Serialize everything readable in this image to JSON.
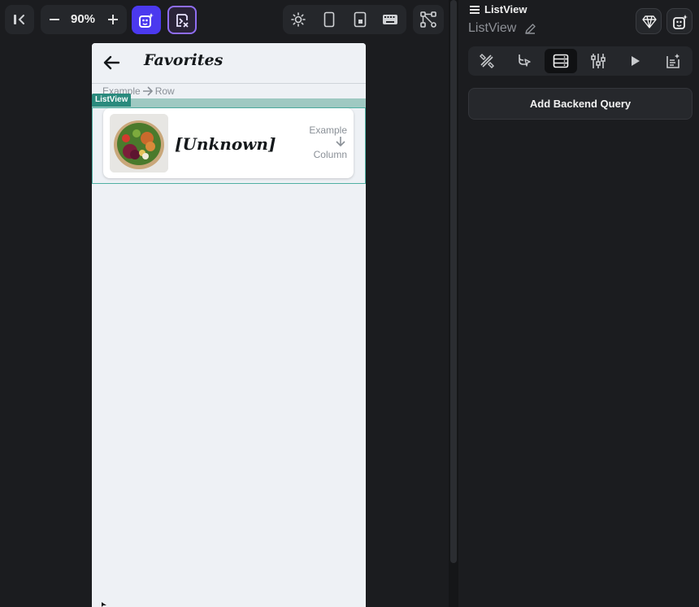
{
  "toolbar": {
    "zoom_value": "90%",
    "icons": [
      "collapse-left-icon",
      "zoom-out-icon",
      "zoom-in-icon",
      "ai-generate-icon",
      "code-check-icon",
      "light-mode-icon",
      "phone-device-icon",
      "tablet-device-icon",
      "keyboard-icon",
      "widget-tree-icon"
    ]
  },
  "phone": {
    "appbar_title": "Favorites",
    "row_hint": {
      "left": "Example",
      "right": "Row"
    },
    "listview_tag": "ListView",
    "card": {
      "title": "[Unknown]",
      "column_hint_top": "Example",
      "column_hint_bottom": "Column"
    }
  },
  "panel": {
    "selected_widget": "ListView",
    "widget_name": "ListView",
    "tabs": [
      {
        "icon": "properties-icon",
        "active": false
      },
      {
        "icon": "actions-icon",
        "active": false
      },
      {
        "icon": "backend-query-icon",
        "active": true
      },
      {
        "icon": "alignment-icon",
        "active": false
      },
      {
        "icon": "animations-icon",
        "active": false
      },
      {
        "icon": "notes-icon",
        "active": false
      }
    ],
    "add_query_label": "Add Backend Query"
  },
  "colors": {
    "accent_purple": "#4b39ef",
    "listview_teal": "#2a8a7d",
    "canvas_bg": "#1b1c1f",
    "phone_bg": "#eef1f5"
  }
}
